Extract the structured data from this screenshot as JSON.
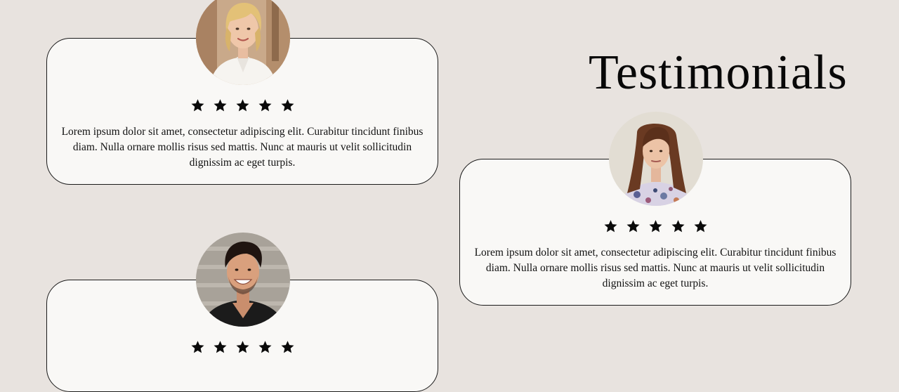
{
  "page": {
    "title": "Testimonials"
  },
  "testimonials": [
    {
      "rating": 5,
      "avatar": "woman-blonde-white-blouse-photo",
      "text": "Lorem ipsum dolor sit amet, consectetur adipiscing elit. Curabitur tincidunt finibus diam. Nulla ornare mollis risus sed mattis. Nunc at mauris ut velit sollicitudin dignissim ac eget turpis."
    },
    {
      "rating": 5,
      "avatar": "woman-brunette-floral-top-photo",
      "text": "Lorem ipsum dolor sit amet, consectetur adipiscing elit. Curabitur tincidunt finibus diam. Nulla ornare mollis risus sed mattis. Nunc at mauris ut velit sollicitudin dignissim ac eget turpis."
    },
    {
      "rating": 5,
      "avatar": "man-dark-hair-smiling-photo"
    }
  ],
  "colors": {
    "background": "#e8e3df",
    "card": "#f9f8f6",
    "border": "#1a1a1a",
    "star": "#0a0a0a"
  },
  "icons": {
    "star": "star-icon"
  }
}
